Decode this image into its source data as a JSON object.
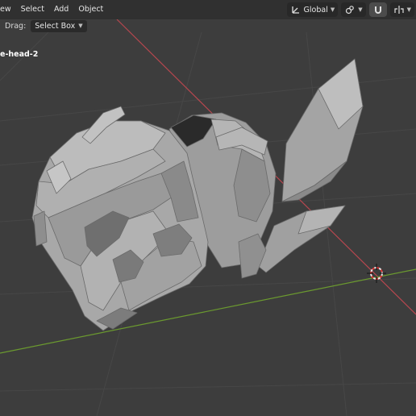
{
  "header": {
    "menus": [
      "ew",
      "Select",
      "Add",
      "Object"
    ],
    "orientation_label": "Global"
  },
  "tool_header": {
    "drag_label": "Drag:",
    "select_mode": "Select Box"
  },
  "viewport": {
    "object_name": "e-head-2",
    "colors": {
      "background": "#3d3d3d",
      "x_axis": "#b8474f",
      "y_axis": "#6b9a2f",
      "mesh": "#a6a6a6"
    }
  },
  "icons": [
    "orientation-icon",
    "pivot-link-icon",
    "snap-magnet-icon",
    "mirror-icon"
  ]
}
